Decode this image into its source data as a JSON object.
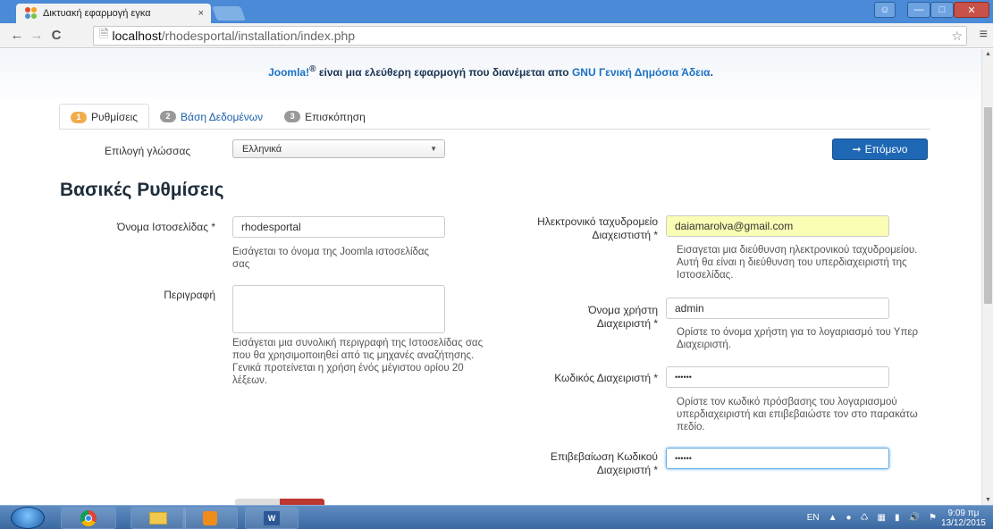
{
  "browser": {
    "tab_title": "Δικτυακή εφαρμογή εγκα",
    "tab_close": "×",
    "url_host": "localhost",
    "url_path": "/rhodesportal/installation/index.php",
    "menu_icon": "hamburger-icon"
  },
  "page": {
    "license_brand": "Joomla!",
    "license_reg": "®",
    "license_text": " είναι μια ελεύθερη εφαρμογή που διανέμεται απο ",
    "license_link": "GNU Γενική Δημόσια Άδεια",
    "license_end": ".",
    "tabs": [
      {
        "num": "1",
        "label": "Ρυθμίσεις"
      },
      {
        "num": "2",
        "label": "Βάση Δεδομένων"
      },
      {
        "num": "3",
        "label": "Επισκόπηση"
      }
    ],
    "language_label": "Επιλογή γλώσσας",
    "language_value": "Ελληνικά",
    "next_button": "Επόμενο",
    "section_title": "Βασικές Ρυθμίσεις",
    "site_name_label": "Όνομα Ιστοσελίδας *",
    "site_name_value": "rhodesportal",
    "site_name_help": "Εισάγεται το όνομα της Joomla ιστοσελίδας σας",
    "description_label": "Περιγραφή",
    "description_help": "Εισάγεται μια συνολική περιγραφή της Ιστοσελίδας σας που θα χρησιμοποιηθεί από τις μηχανές αναζήτησης. Γενικά προτείνεται η χρήση ένός μέγιστου ορίου 20 λέξεων.",
    "email_label_1": "Ηλεκτρονικό ταχυδρομείο",
    "email_label_2": "Διαχειστιστή *",
    "email_value": "daiamarolva@gmail.com",
    "email_help": "Εισαγεται μια διεύθυνση ηλεκτρονικού ταχυδρομείου. Αυτή θα είναι η διεύθυνση του υπερδιαχειριστή της Ιστοσελίδας.",
    "username_label_1": "Όνομα χρήστη",
    "username_label_2": "Διαχειριστή *",
    "username_value": "admin",
    "username_help": "Ορίστε το όνομα χρήστη για το λογαριασμό του Υπερ Διαχειριστή.",
    "password_label": "Κωδικός Διαχειριστή *",
    "password_value": "••••••",
    "password_help": "Ορίστε τον κωδικό πρόσβασης του λογαριασμού υπερδιαχειριστή και επιβεβαιώστε τον στο παρακάτω πεδίο.",
    "confirm_label_1": "Επιβεβαίωση Κωδικού",
    "confirm_label_2": "Διαχειριστή *",
    "confirm_value": "••••••"
  },
  "taskbar": {
    "lang": "EN",
    "time": "9:09 πμ",
    "date": "13/12/2015"
  },
  "colors": {
    "accent_blue": "#1e67b4",
    "step_orange": "#f0ad4e",
    "titlebar": "#4a8ad6"
  }
}
